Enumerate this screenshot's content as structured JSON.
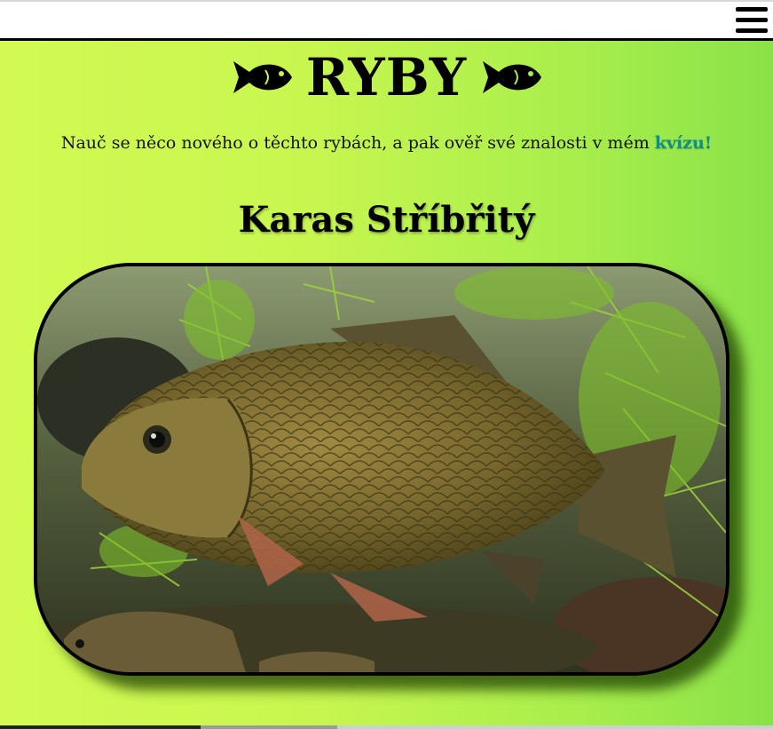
{
  "header": {
    "menu_icon": "hamburger-menu-icon"
  },
  "hero": {
    "title": "RYBY",
    "left_icon": "fish-icon",
    "right_icon": "fish-icon",
    "intro_text": "Nauč se něco nového o těchto rybách, a pak ověř své znalosti v mém ",
    "quiz_link_label": "kvízu!"
  },
  "fish": {
    "name": "Karas Stříbřitý",
    "photo": "crucian-carp-photo"
  },
  "colors": {
    "gradient_start": "#d2fa52",
    "gradient_end": "#8ae248",
    "link": "#0f8f86",
    "text": "#000000"
  }
}
